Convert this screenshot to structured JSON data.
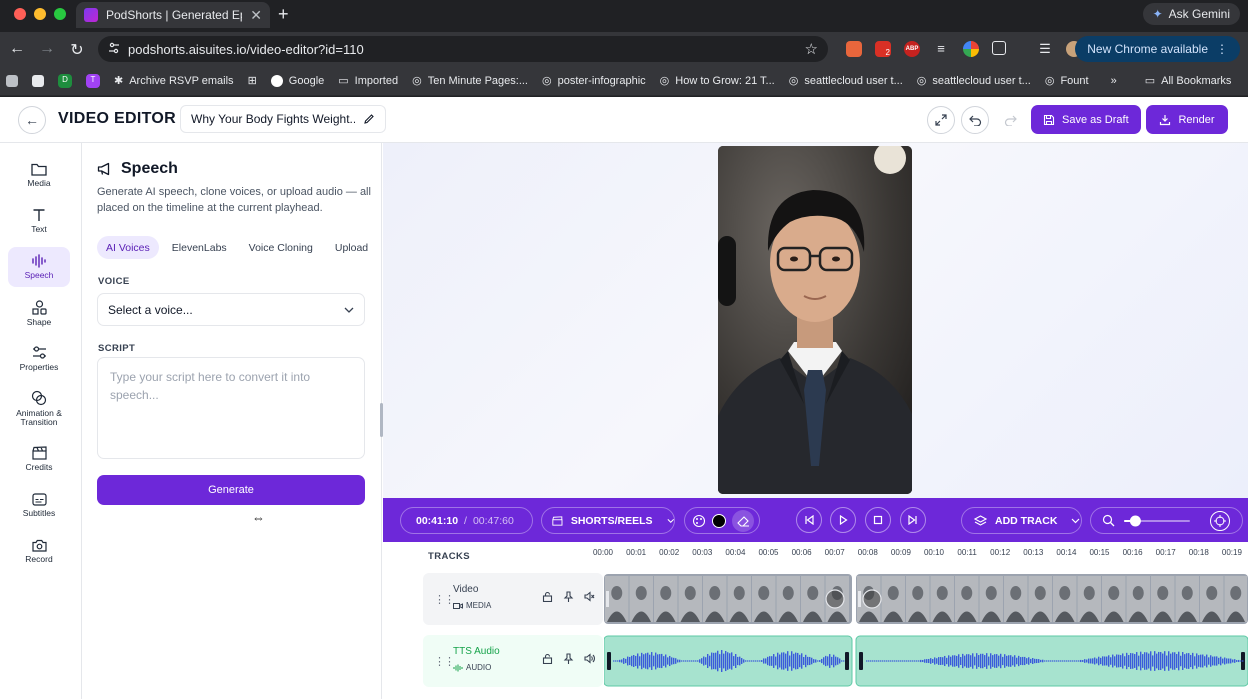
{
  "browser": {
    "tab_title": "PodShorts | Generated Episod",
    "ask_gemini": "Ask Gemini",
    "url": "podshorts.aisuites.io/video-editor?id=110",
    "new_chrome": "New Chrome available",
    "ext_badge": "2",
    "ext_abp": "ABP",
    "bookmarks": [
      {
        "label": "Archive RSVP emails"
      },
      {
        "label": "Google"
      },
      {
        "label": "Imported"
      },
      {
        "label": "Ten Minute Pages:..."
      },
      {
        "label": "poster-infographic"
      },
      {
        "label": "How to Grow: 21 T..."
      },
      {
        "label": "seattlecloud user t..."
      },
      {
        "label": "seattlecloud user t..."
      },
      {
        "label": "Fount"
      }
    ],
    "bm_letters": [
      "D",
      "T"
    ],
    "more": "»",
    "all_bookmarks": "All Bookmarks"
  },
  "header": {
    "title": "VIDEO EDITOR",
    "project_name": "Why Your Body Fights Weight...",
    "save_draft": "Save as Draft",
    "render": "Render"
  },
  "rail": [
    {
      "label": "Media",
      "icon": "folder-icon"
    },
    {
      "label": "Text",
      "icon": "text-icon"
    },
    {
      "label": "Speech",
      "icon": "waveform-icon",
      "active": true
    },
    {
      "label": "Shape",
      "icon": "shapes-icon"
    },
    {
      "label": "Properties",
      "icon": "sliders-icon"
    },
    {
      "label": "Animation & Transition",
      "icon": "animation-icon"
    },
    {
      "label": "Credits",
      "icon": "clapper-icon"
    },
    {
      "label": "Subtitles",
      "icon": "subtitles-icon"
    },
    {
      "label": "Record",
      "icon": "camera-icon"
    }
  ],
  "speech": {
    "title": "Speech",
    "description": "Generate AI speech, clone voices, or upload audio — all placed on the timeline at the current playhead.",
    "tabs": [
      "AI Voices",
      "ElevenLabs",
      "Voice Cloning",
      "Upload"
    ],
    "active_tab": "AI Voices",
    "voice_label": "VOICE",
    "voice_placeholder": "Select a voice...",
    "script_label": "SCRIPT",
    "script_placeholder": "Type your script here to convert it into speech...",
    "generate": "Generate"
  },
  "transport": {
    "current_time": "00:41:10",
    "separator": "/",
    "total_time": "00:47:60",
    "format": "SHORTS/REELS",
    "add_track": "ADD TRACK",
    "zoom_level": 0.1
  },
  "timeline": {
    "tracks_label": "TRACKS",
    "ticks": [
      "00:00",
      "00:01",
      "00:02",
      "00:03",
      "00:04",
      "00:05",
      "00:06",
      "00:07",
      "00:08",
      "00:09",
      "00:10",
      "00:11",
      "00:12",
      "00:13",
      "00:14",
      "00:15",
      "00:16",
      "00:17",
      "00:18",
      "00:19"
    ],
    "tracks": [
      {
        "name": "Video",
        "type": "MEDIA"
      },
      {
        "name": "TTS Audio",
        "type": "AUDIO"
      }
    ]
  },
  "colors": {
    "accent": "#6d28d9",
    "accent_light": "#ede9fe",
    "audio_clip": "#a7e3cf",
    "waveform": "#3b5bdb",
    "audio_name": "#16a34a"
  }
}
